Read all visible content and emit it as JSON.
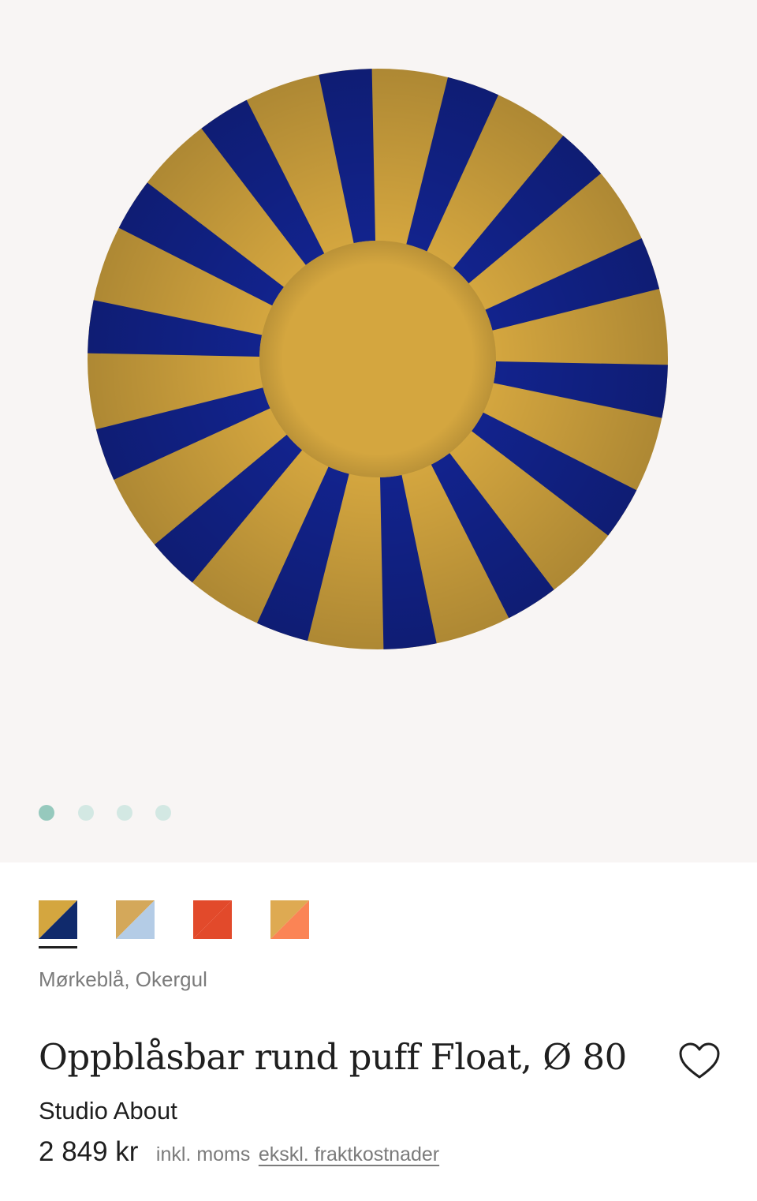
{
  "gallery": {
    "image_alt": "Oppblåsbar rund puff Float, Ø 80",
    "slide_count": 4,
    "active_slide": 1,
    "colors": {
      "navy": "#12238d",
      "ochre": "#d4a63f",
      "background": "#f8f5f4"
    }
  },
  "pagination": {
    "dots": [
      {
        "state": "active"
      },
      {
        "state": "inactive"
      },
      {
        "state": "inactive"
      },
      {
        "state": "inactive"
      }
    ]
  },
  "variants": {
    "selected_index": 0,
    "swatches": [
      {
        "colors": [
          "#d4a63f",
          "#102a6c"
        ],
        "selected": true
      },
      {
        "colors": [
          "#d4a85a",
          "#b4cce6"
        ],
        "selected": false
      },
      {
        "colors": [
          "#e24a2b",
          "#e24a2b"
        ],
        "selected": false
      },
      {
        "colors": [
          "#deaa52",
          "#fb8455"
        ],
        "selected": false
      }
    ],
    "selected_name": "Mørkeblå, Okergul"
  },
  "product": {
    "title": "Oppblåsbar rund puff Float, Ø 80",
    "brand": "Studio About",
    "price": "2 849 kr",
    "vat_note": "inkl. moms",
    "shipping_note": "ekskl. fraktkostnader",
    "wishlist_icon": "heart-outline-icon"
  }
}
